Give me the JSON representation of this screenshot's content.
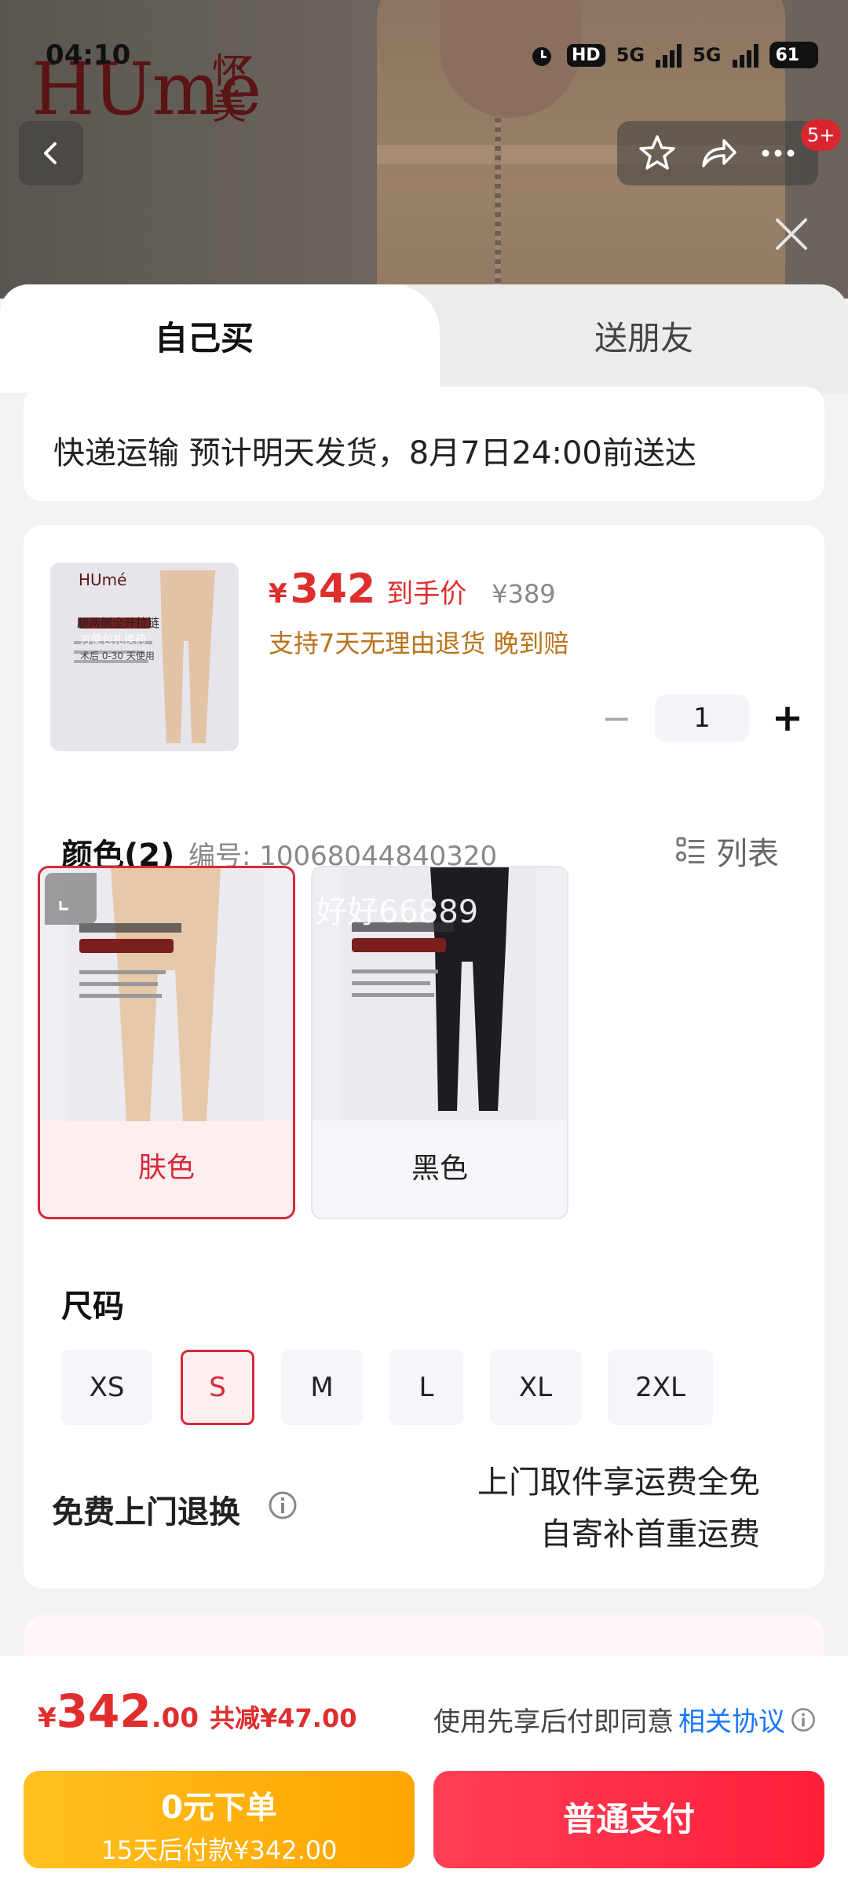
{
  "status_bar": {
    "time": "04:10",
    "hd": "HD",
    "net1": "5G",
    "net2": "5G",
    "battery": "61"
  },
  "header": {
    "brand_latin": "HUmé",
    "brand_cn": "怀美",
    "cart_badge": "5+"
  },
  "tabs": [
    {
      "label": "自己买",
      "active": true
    },
    {
      "label": "送朋友",
      "active": false
    }
  ],
  "delivery": {
    "text": "快递运输 预计明天发货，8月7日24:00前送达"
  },
  "product": {
    "thumb_brand": "HUmé",
    "thumb_caption_1": "腿两侧全开拉链",
    "thumb_caption_2": "方便包扎换药",
    "thumb_caption_3": "术后 0-30 天使用",
    "price_currency": "¥",
    "price": "342",
    "price_tag": "到手价",
    "original_price": "¥389",
    "promises": "支持7天无理由退货  晚到赔",
    "quantity": "1"
  },
  "color_section": {
    "title": "颜色(2)",
    "sku": "编号: 10068044840320",
    "list_label": "列表",
    "options": [
      {
        "label": "肤色",
        "selected": true
      },
      {
        "label": "黑色",
        "selected": false
      }
    ],
    "watermark": "好好66889"
  },
  "size_section": {
    "title": "尺码",
    "options": [
      {
        "label": "XS",
        "selected": false
      },
      {
        "label": "S",
        "selected": true
      },
      {
        "label": "M",
        "selected": false
      },
      {
        "label": "L",
        "selected": false
      },
      {
        "label": "XL",
        "selected": false
      },
      {
        "label": "2XL",
        "selected": false
      }
    ]
  },
  "return_service": {
    "title": "免费上门退换",
    "line1": "上门取件享运费全免",
    "line2": "自寄补首重运费"
  },
  "footer": {
    "total_currency": "¥",
    "total_int": "342",
    "total_dec": ".00",
    "total_saving": "共减¥47.00",
    "agree_prefix": "使用先享后付即同意",
    "agree_link": "相关协议",
    "bnpl_line1": "0元下单",
    "bnpl_line2": "15天后付款¥342.00",
    "pay_label": "普通支付"
  },
  "colors": {
    "accent_red": "#e02e2e",
    "select_red": "#d7293a",
    "promise_brown": "#b8741a",
    "link_blue": "#1677ff",
    "bnpl_yellow": "#ffb000",
    "pay_red": "#ff2a45"
  }
}
